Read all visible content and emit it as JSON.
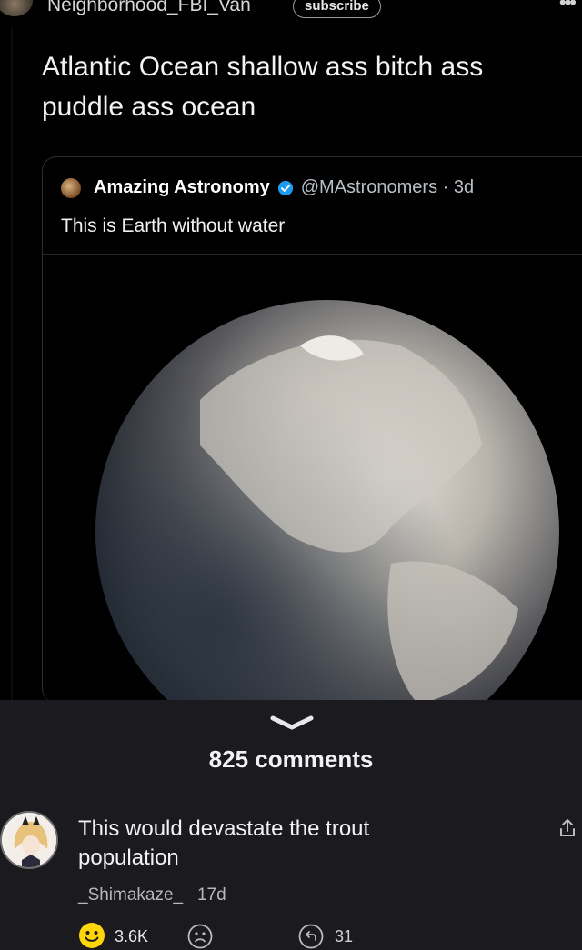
{
  "post": {
    "username": "Neighborhood_FBI_Van",
    "subscribe_label": "subscribe",
    "more_label": "•••",
    "title": "Atlantic Ocean shallow ass bitch ass puddle ass ocean"
  },
  "quoted_tweet": {
    "display_name": "Amazing Astronomy",
    "handle_time": "@MAstronomers · 3d",
    "text": "This is Earth without water",
    "image_icon": "earth-without-water-image"
  },
  "comments": {
    "count_label": "825 comments"
  },
  "comment": {
    "text": "This would devastate the trout population",
    "username": "_Shimakaze_",
    "time": "17d",
    "likes": "3.6K",
    "replies": "31"
  },
  "colors": {
    "post_bg": "#000000",
    "page_bg": "#1b1b1f",
    "smile_yellow": "#ffd60a",
    "verified_blue": "#1d9bf0"
  }
}
